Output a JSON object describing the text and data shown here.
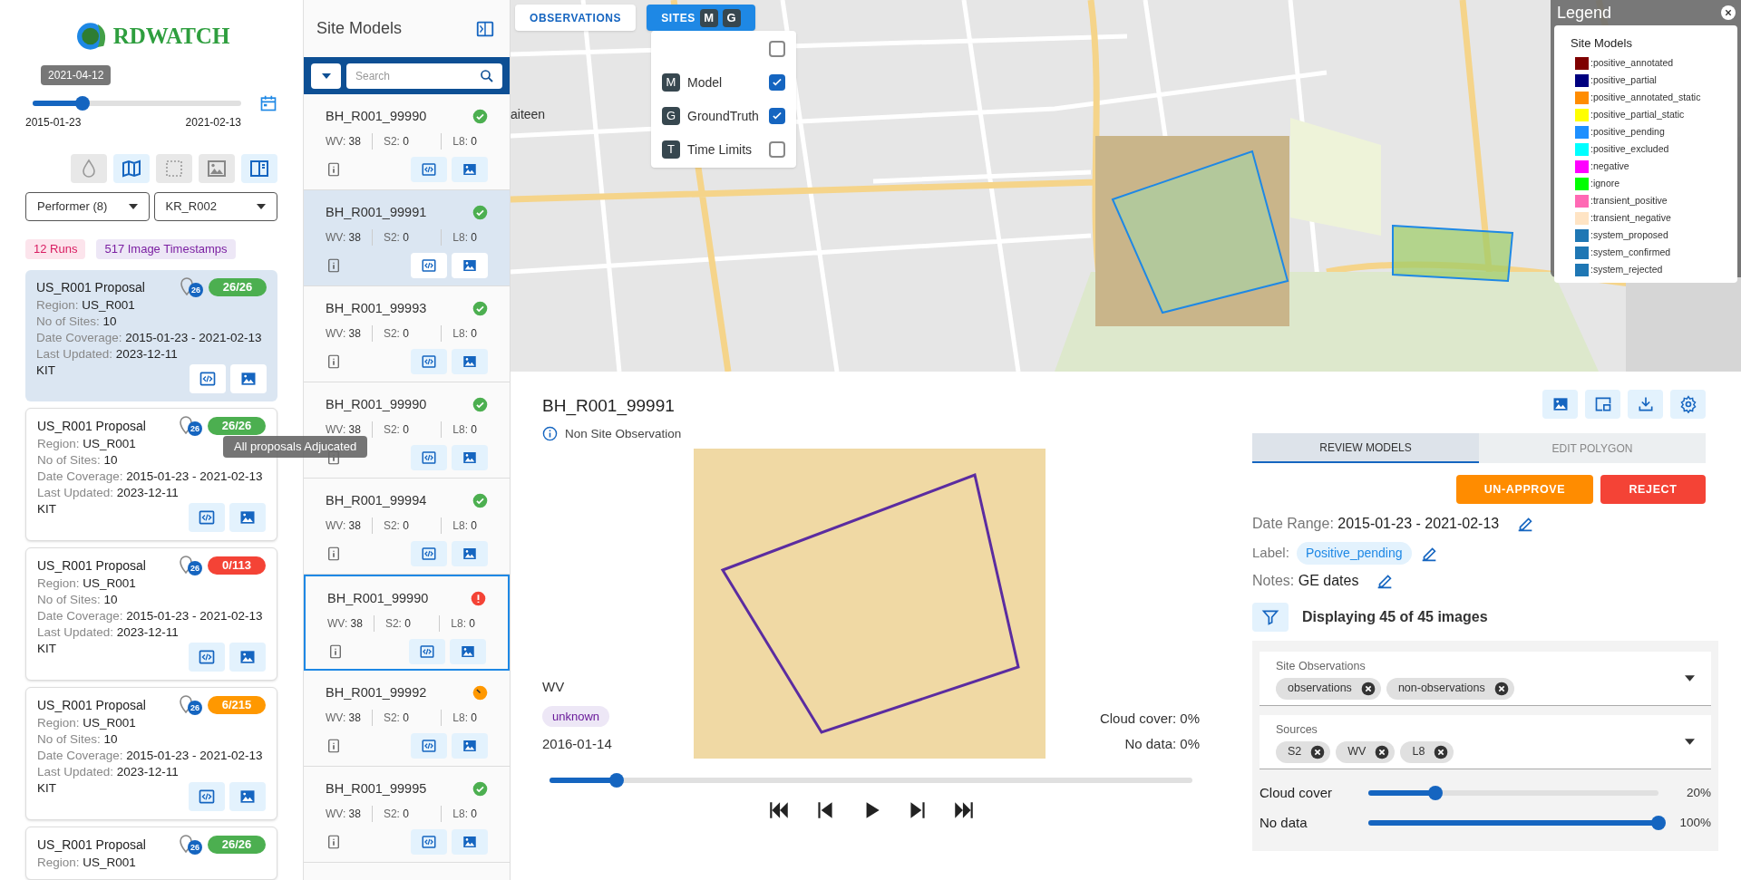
{
  "logo": {
    "text": "RDWATCH"
  },
  "time_slider": {
    "tooltip": "2021-04-12",
    "level": 0.24,
    "start": "2015-01-23",
    "end": "2021-02-13"
  },
  "toolbar": [
    {
      "kind": "drop",
      "on": false
    },
    {
      "kind": "map",
      "on": true
    },
    {
      "kind": "box",
      "on": false
    },
    {
      "kind": "image",
      "on": false
    },
    {
      "kind": "panel",
      "on": true
    }
  ],
  "filters": [
    {
      "value": "Performer (8)"
    },
    {
      "value": "KR_R002"
    }
  ],
  "tags": [
    {
      "kind": "runs",
      "text": "12 Runs"
    },
    {
      "kind": "timestamps",
      "text": "517 Image Timestamps"
    }
  ],
  "runs": [
    {
      "title": "US_R001 Proposal",
      "site_count": "26",
      "progress": "26/26",
      "color": "#4caf50",
      "selected": true,
      "fields": [
        {
          "label": "Region:",
          "value": "US_R001"
        },
        {
          "label": "No of Sites:",
          "value": "10"
        },
        {
          "label": "Date Coverage:",
          "value": "2015-01-23 - 2021-02-13"
        },
        {
          "label": "Last Updated:",
          "value": "2023-12-11"
        }
      ],
      "performer": "KIT"
    },
    {
      "title": "US_R001 Proposal",
      "site_count": "26",
      "progress": "26/26",
      "color": "#4caf50",
      "selected": false,
      "fields": [
        {
          "label": "Region:",
          "value": "US_R001"
        },
        {
          "label": "No of Sites:",
          "value": "10"
        },
        {
          "label": "Date Coverage:",
          "value": "2015-01-23 - 2021-02-13"
        },
        {
          "label": "Last Updated:",
          "value": "2023-12-11"
        }
      ],
      "performer": "KIT"
    },
    {
      "title": "US_R001 Proposal",
      "site_count": "26",
      "progress": "0/113",
      "color": "#f44336",
      "selected": false,
      "fields": [
        {
          "label": "Region:",
          "value": "US_R001"
        },
        {
          "label": "No of Sites:",
          "value": "10"
        },
        {
          "label": "Date Coverage:",
          "value": "2015-01-23 - 2021-02-13"
        },
        {
          "label": "Last Updated:",
          "value": "2023-12-11"
        }
      ],
      "performer": "KIT"
    },
    {
      "title": "US_R001 Proposal",
      "site_count": "26",
      "progress": "6/215",
      "color": "#ff9800",
      "selected": false,
      "fields": [
        {
          "label": "Region:",
          "value": "US_R001"
        },
        {
          "label": "No of Sites:",
          "value": "10"
        },
        {
          "label": "Date Coverage:",
          "value": "2015-01-23 - 2021-02-13"
        },
        {
          "label": "Last Updated:",
          "value": "2023-12-11"
        }
      ],
      "performer": "KIT"
    },
    {
      "title": "US_R001 Proposal",
      "site_count": "26",
      "progress": "26/26",
      "color": "#4caf50",
      "selected": false,
      "fields": [
        {
          "label": "Region:",
          "value": "US_R001"
        }
      ]
    }
  ],
  "tooltip": {
    "text": "All proposals Adjucated"
  },
  "site_models": {
    "title": "Site Models",
    "search": {
      "placeholder": "Search"
    },
    "items": [
      {
        "title": "BH_R001_99990",
        "status": {
          "kind": "ok"
        },
        "selected": false,
        "focused": false,
        "counts": [
          {
            "label": "WV:",
            "value": "38"
          },
          {
            "label": "S2:",
            "value": "0"
          },
          {
            "label": "L8:",
            "value": "0"
          }
        ]
      },
      {
        "title": "BH_R001_99991",
        "status": {
          "kind": "ok"
        },
        "selected": true,
        "focused": false,
        "counts": [
          {
            "label": "WV:",
            "value": "38"
          },
          {
            "label": "S2:",
            "value": "0"
          },
          {
            "label": "L8:",
            "value": "0"
          }
        ]
      },
      {
        "title": "BH_R001_99993",
        "status": {
          "kind": "ok"
        },
        "selected": false,
        "focused": false,
        "counts": [
          {
            "label": "WV:",
            "value": "38"
          },
          {
            "label": "S2:",
            "value": "0"
          },
          {
            "label": "L8:",
            "value": "0"
          }
        ]
      },
      {
        "title": "BH_R001_99990",
        "status": {
          "kind": "ok"
        },
        "selected": false,
        "focused": false,
        "counts": [
          {
            "label": "WV:",
            "value": "38"
          },
          {
            "label": "S2:",
            "value": "0"
          },
          {
            "label": "L8:",
            "value": "0"
          }
        ]
      },
      {
        "title": "BH_R001_99994",
        "status": {
          "kind": "ok"
        },
        "selected": false,
        "focused": false,
        "counts": [
          {
            "label": "WV:",
            "value": "38"
          },
          {
            "label": "S2:",
            "value": "0"
          },
          {
            "label": "L8:",
            "value": "0"
          }
        ]
      },
      {
        "title": "BH_R001_99990",
        "status": {
          "kind": "error"
        },
        "selected": false,
        "focused": true,
        "counts": [
          {
            "label": "WV:",
            "value": "38"
          },
          {
            "label": "S2:",
            "value": "0"
          },
          {
            "label": "L8:",
            "value": "0"
          }
        ]
      },
      {
        "title": "BH_R001_99992",
        "status": {
          "kind": "pending"
        },
        "selected": false,
        "focused": false,
        "counts": [
          {
            "label": "WV:",
            "value": "38"
          },
          {
            "label": "S2:",
            "value": "0"
          },
          {
            "label": "L8:",
            "value": "0"
          }
        ]
      },
      {
        "title": "BH_R001_99995",
        "status": {
          "kind": "ok"
        },
        "selected": false,
        "focused": false,
        "counts": [
          {
            "label": "WV:",
            "value": "38"
          },
          {
            "label": "S2:",
            "value": "0"
          },
          {
            "label": "L8:",
            "value": "0"
          }
        ]
      }
    ]
  },
  "map": {
    "tabs": [
      {
        "label": "OBSERVATIONS",
        "selected": false
      },
      {
        "label": "SITES",
        "selected": true,
        "keys": [
          "M",
          "G"
        ]
      }
    ],
    "layers": [
      {
        "checked": false
      },
      {
        "key": "M",
        "label": "Model",
        "checked": true
      },
      {
        "key": "G",
        "label": "GroundTruth",
        "checked": true
      },
      {
        "key": "T",
        "label": "Time Limits",
        "checked": false
      }
    ],
    "place_labels": [
      "aiteen"
    ],
    "legend": {
      "title": "Legend",
      "section": "Site Models",
      "items": [
        {
          "label": ":positive_annotated",
          "color": "#7f0000"
        },
        {
          "label": ":positive_partial",
          "color": "#00007f"
        },
        {
          "label": ":positive_annotated_static",
          "color": "#ff8c00"
        },
        {
          "label": ":positive_partial_static",
          "color": "#ffff00"
        },
        {
          "label": ":positive_pending",
          "color": "#1e90ff"
        },
        {
          "label": ":positive_excluded",
          "color": "#00ffff"
        },
        {
          "label": ":negative",
          "color": "#ff00ff"
        },
        {
          "label": ":ignore",
          "color": "#00ff00"
        },
        {
          "label": ":transient_positive",
          "color": "#ff69b4"
        },
        {
          "label": ":transient_negative",
          "color": "#ffe4c4"
        },
        {
          "label": ":system_proposed",
          "color": "#1f77b4"
        },
        {
          "label": ":system_confirmed",
          "color": "#1f77b4"
        },
        {
          "label": ":system_rejected",
          "color": "#1f77b4"
        }
      ]
    }
  },
  "detail": {
    "title": "BH_R001_99991",
    "observation": "Non Site Observation",
    "source": "WV",
    "chip": "unknown",
    "date": "2016-01-14",
    "cloud_cover": "Cloud cover: 0%",
    "no_data": "No data: 0%",
    "timeline": {
      "level": 0.105
    },
    "playback": [
      {
        "kind": "first"
      },
      {
        "kind": "prev"
      },
      {
        "kind": "play"
      },
      {
        "kind": "next"
      },
      {
        "kind": "last"
      }
    ]
  },
  "review": {
    "tools": [
      {
        "kind": "image"
      },
      {
        "kind": "pip"
      },
      {
        "kind": "download"
      },
      {
        "kind": "settings"
      }
    ],
    "tabs": [
      {
        "label": "REVIEW MODELS",
        "selected": true
      },
      {
        "label": "EDIT POLYGON",
        "selected": false
      }
    ],
    "actions": [
      {
        "kind": "unapprove",
        "label": "UN-APPROVE"
      },
      {
        "kind": "reject",
        "label": "REJECT"
      }
    ],
    "date_range": {
      "label": "Date Range:",
      "value": "2015-01-23 - 2021-02-13"
    },
    "label": {
      "label": "Label:",
      "value": "Positive_pending"
    },
    "notes": {
      "label": "Notes:",
      "value": "GE dates"
    },
    "summary": "Displaying 45 of 45 images",
    "selects": [
      {
        "label": "Site Observations",
        "chips": [
          "observations",
          "non-observations"
        ]
      },
      {
        "label": "Sources",
        "chips": [
          "S2",
          "WV",
          "L8"
        ]
      }
    ],
    "sliders": [
      {
        "label": "Cloud cover",
        "level": 0.23,
        "reading": "20%"
      },
      {
        "label": "No data",
        "level": 1,
        "reading": "100%"
      }
    ]
  }
}
